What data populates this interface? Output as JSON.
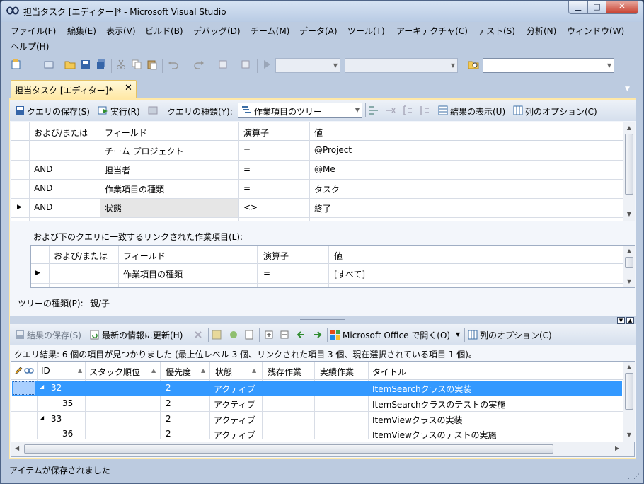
{
  "window": {
    "title": "担当タスク [エディター]* - Microsoft Visual Studio",
    "min_glyph": "▁",
    "max_glyph": "□",
    "close_glyph": "✕"
  },
  "menu": [
    "ファイル(F)",
    "編集(E)",
    "表示(V)",
    "ビルド(B)",
    "デバッグ(D)",
    "チーム(M)",
    "データ(A)",
    "ツール(T)",
    "アーキテクチャ(C)",
    "テスト(S)",
    "分析(N)",
    "ウィンドウ(W)",
    "ヘルプ(H)"
  ],
  "tab": {
    "label": "担当タスク [エディター]*",
    "close": "✕"
  },
  "query_toolbar": {
    "save": "クエリの保存(S)",
    "run": "実行(R)",
    "type_label": "クエリの種類(Y):",
    "type_value": "作業項目のツリー",
    "show_results": "結果の表示(U)",
    "column_options": "列のオプション(C)"
  },
  "clause_grid": {
    "headers": [
      "および/または",
      "フィールド",
      "演算子",
      "値"
    ],
    "rows": [
      {
        "andor": "",
        "field": "チーム プロジェクト",
        "op": "=",
        "value": "@Project"
      },
      {
        "andor": "AND",
        "field": "担当者",
        "op": "=",
        "value": "@Me"
      },
      {
        "andor": "AND",
        "field": "作業項目の種類",
        "op": "=",
        "value": "タスク"
      },
      {
        "andor": "AND",
        "field": "状態",
        "op": "<>",
        "value": "終了"
      }
    ]
  },
  "linked_label": "および下のクエリに一致するリンクされた作業項目(L):",
  "linked_grid": {
    "headers": [
      "および/または",
      "フィールド",
      "演算子",
      "値"
    ],
    "rows": [
      {
        "andor": "",
        "field": "作業項目の種類",
        "op": "=",
        "value": "[すべて]"
      }
    ]
  },
  "tree_type": {
    "label": "ツリーの種類(P):",
    "value": "親/子"
  },
  "results_toolbar": {
    "save": "結果の保存(S)",
    "refresh": "最新の情報に更新(H)",
    "open_office": "Microsoft Office で開く(O)",
    "column_options": "列のオプション(C)"
  },
  "results_info": "クエリ結果: 6 個の項目が見つかりました (最上位レベル 3 個、リンクされた項目 3 個、現在選択されている項目 1 個)。",
  "results_grid": {
    "headers": [
      "ID",
      "スタック順位",
      "優先度",
      "状態",
      "残存作業",
      "実績作業",
      "タイトル"
    ],
    "rows": [
      {
        "expander": "◢",
        "id": "32",
        "rank": "",
        "priority": "2",
        "state": "アクティブ",
        "remaining": "",
        "completed": "",
        "title": "ItemSearchクラスの実装",
        "selected": true
      },
      {
        "expander": "",
        "id": "35",
        "rank": "",
        "priority": "2",
        "state": "アクティブ",
        "remaining": "",
        "completed": "",
        "title": "ItemSearchクラスのテストの実施",
        "selected": false
      },
      {
        "expander": "◢",
        "id": "33",
        "rank": "",
        "priority": "2",
        "state": "アクティブ",
        "remaining": "",
        "completed": "",
        "title": "ItemViewクラスの実装",
        "selected": false
      },
      {
        "expander": "",
        "id": "36",
        "rank": "",
        "priority": "2",
        "state": "アクティブ",
        "remaining": "",
        "completed": "",
        "title": "ItemViewクラスのテストの実施",
        "selected": false
      }
    ]
  },
  "status": "アイテムが保存されました",
  "colors": {
    "selection": "#3399ff",
    "tab": "#ffe8a6",
    "chrome": "#bccbe0"
  }
}
